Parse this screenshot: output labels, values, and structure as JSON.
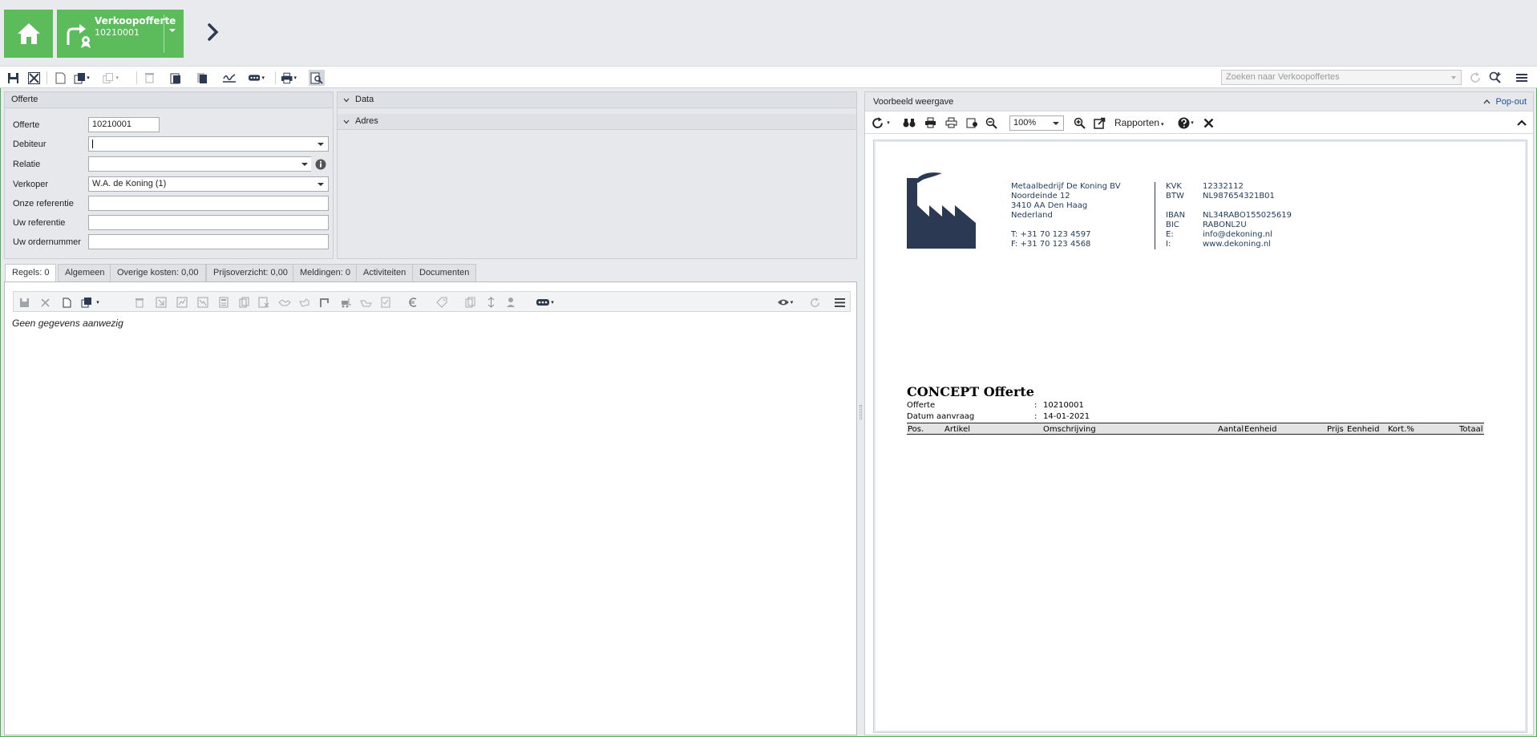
{
  "module": {
    "title": "Verkoopofferte",
    "number": "10210001"
  },
  "toolbar": {
    "search_placeholder": "Zoeken naar Verkoopoffertes"
  },
  "offerte_panel": {
    "title": "Offerte",
    "fields": {
      "offerte_label": "Offerte",
      "offerte_value": "10210001",
      "debiteur_label": "Debiteur",
      "debiteur_value": "",
      "relatie_label": "Relatie",
      "relatie_value": "",
      "verkoper_label": "Verkoper",
      "verkoper_value": "W.A. de Koning (1)",
      "onze_referentie_label": "Onze referentie",
      "uw_referentie_label": "Uw referentie",
      "uw_ordernummer_label": "Uw ordernummer"
    }
  },
  "sections": {
    "data": "Data",
    "adres": "Adres"
  },
  "tabs": [
    {
      "label": "Regels: 0",
      "active": true
    },
    {
      "label": "Algemeen"
    },
    {
      "label": "Overige kosten: 0,00"
    },
    {
      "label": "Prijsoverzicht: 0,00"
    },
    {
      "label": "Meldingen: 0"
    },
    {
      "label": "Activiteiten"
    },
    {
      "label": "Documenten"
    }
  ],
  "detail": {
    "empty_message": "Geen gegevens aanwezig"
  },
  "preview": {
    "title": "Voorbeeld weergave",
    "popout": "Pop-out",
    "zoom": "100%",
    "rapporten": "Rapporten"
  },
  "document": {
    "company": {
      "name": "Metaalbedrijf De Koning BV",
      "street": "Noordeinde 12",
      "city": "3410 AA  Den Haag",
      "country": "Nederland",
      "phone": "T: +31 70 123 4597",
      "fax": "F: +31 70 123 4568"
    },
    "ids": {
      "kvk_label": "KVK",
      "kvk": "12332112",
      "btw_label": "BTW",
      "btw": "NL987654321B01",
      "iban_label": "IBAN",
      "iban": "NL34RABO155025619",
      "bic_label": "BIC",
      "bic": "RABONL2U",
      "e_label": "E:",
      "email": "info@dekoning.nl",
      "i_label": "I:",
      "web": "www.dekoning.nl"
    },
    "title": "CONCEPT Offerte",
    "offerte_label": "Offerte",
    "offerte_value": "10210001",
    "datum_label": "Datum aanvraag",
    "datum_value": "14-01-2021",
    "colon": ":",
    "columns": {
      "pos": "Pos.",
      "artikel": "Artikel",
      "omschrijving": "Omschrijving",
      "aantal": "Aantal",
      "eenheid": "Eenheid",
      "prijs": "Prijs",
      "eenheid2": "Eenheid",
      "kort": "Kort.%",
      "totaal": "Totaal"
    }
  },
  "colors": {
    "accent_green": "#5cbc5c",
    "brand_navy": "#2b3a52",
    "link_blue": "#1f4e9c"
  }
}
